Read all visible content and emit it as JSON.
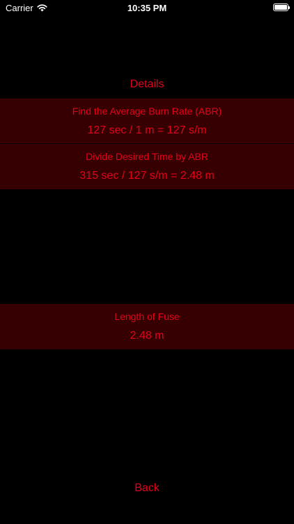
{
  "status_bar": {
    "carrier": "Carrier",
    "time": "10:35 PM"
  },
  "details": {
    "title": "Details"
  },
  "steps": [
    {
      "label": "Find the Average Burn Rate (ABR)",
      "value": "127 sec / 1 m = 127 s/m"
    },
    {
      "label": "Divide Desired Time by ABR",
      "value": "315 sec / 127 s/m = 2.48 m"
    }
  ],
  "result": {
    "label": "Length of Fuse",
    "value": "2.48 m"
  },
  "back": {
    "label": "Back"
  },
  "colors": {
    "accent_text": "#e4001b",
    "panel_background": "#360003",
    "background": "#000000"
  },
  "icons": {
    "wifi": "wifi-icon",
    "battery": "battery-icon"
  }
}
